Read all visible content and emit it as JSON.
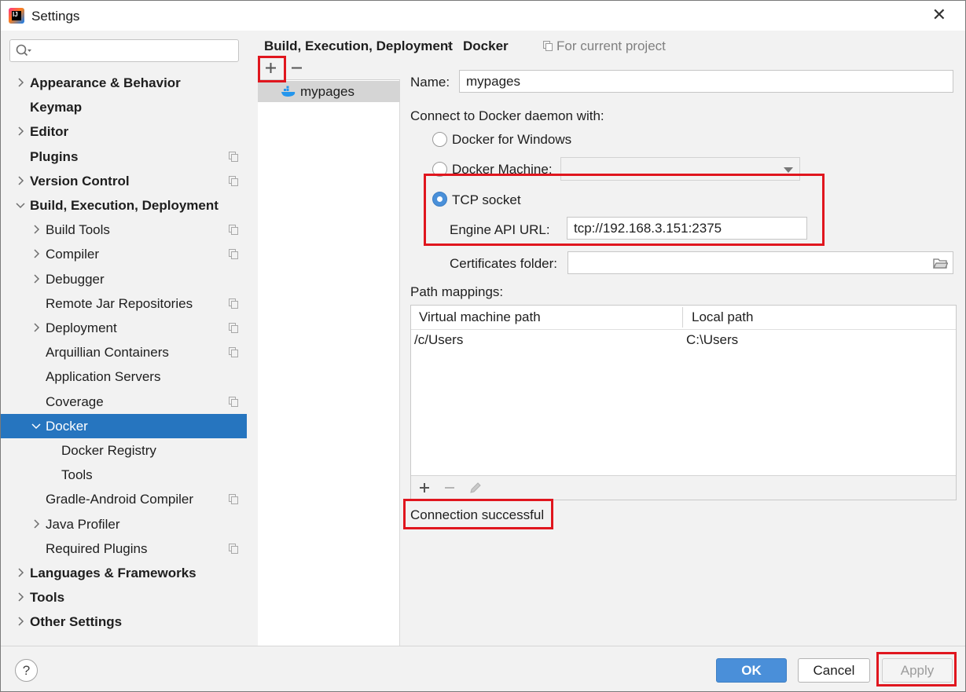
{
  "window": {
    "title": "Settings",
    "app_icon_text": "IJ"
  },
  "sidebar": {
    "search_placeholder": "",
    "items": [
      {
        "label": "Appearance & Behavior",
        "bold": true,
        "level": 0,
        "chevron": "right"
      },
      {
        "label": "Keymap",
        "bold": true,
        "level": 0,
        "chevron": "none"
      },
      {
        "label": "Editor",
        "bold": true,
        "level": 0,
        "chevron": "right"
      },
      {
        "label": "Plugins",
        "bold": true,
        "level": 0,
        "chevron": "none",
        "project": true
      },
      {
        "label": "Version Control",
        "bold": true,
        "level": 0,
        "chevron": "right",
        "project": true
      },
      {
        "label": "Build, Execution, Deployment",
        "bold": true,
        "level": 0,
        "chevron": "down"
      },
      {
        "label": "Build Tools",
        "bold": false,
        "level": 1,
        "chevron": "right",
        "project": true
      },
      {
        "label": "Compiler",
        "bold": false,
        "level": 1,
        "chevron": "right",
        "project": true
      },
      {
        "label": "Debugger",
        "bold": false,
        "level": 1,
        "chevron": "right"
      },
      {
        "label": "Remote Jar Repositories",
        "bold": false,
        "level": 1,
        "chevron": "none",
        "project": true
      },
      {
        "label": "Deployment",
        "bold": false,
        "level": 1,
        "chevron": "right",
        "project": true
      },
      {
        "label": "Arquillian Containers",
        "bold": false,
        "level": 1,
        "chevron": "none",
        "project": true
      },
      {
        "label": "Application Servers",
        "bold": false,
        "level": 1,
        "chevron": "none"
      },
      {
        "label": "Coverage",
        "bold": false,
        "level": 1,
        "chevron": "none",
        "project": true
      },
      {
        "label": "Docker",
        "bold": false,
        "level": 1,
        "chevron": "down",
        "selected": true
      },
      {
        "label": "Docker Registry",
        "bold": false,
        "level": 2,
        "chevron": "none"
      },
      {
        "label": "Tools",
        "bold": false,
        "level": 2,
        "chevron": "none"
      },
      {
        "label": "Gradle-Android Compiler",
        "bold": false,
        "level": 1,
        "chevron": "none",
        "project": true
      },
      {
        "label": "Java Profiler",
        "bold": false,
        "level": 1,
        "chevron": "right"
      },
      {
        "label": "Required Plugins",
        "bold": false,
        "level": 1,
        "chevron": "none",
        "project": true
      },
      {
        "label": "Languages & Frameworks",
        "bold": true,
        "level": 0,
        "chevron": "right"
      },
      {
        "label": "Tools",
        "bold": true,
        "level": 0,
        "chevron": "right"
      },
      {
        "label": "Other Settings",
        "bold": true,
        "level": 0,
        "chevron": "right"
      }
    ]
  },
  "breadcrumb": {
    "parent": "Build, Execution, Deployment",
    "current": "Docker",
    "scope": "For current project"
  },
  "docker_list": {
    "items": [
      "mypages"
    ]
  },
  "form": {
    "name_label": "Name:",
    "name_value": "mypages",
    "connect_label": "Connect to Docker daemon with:",
    "option_windows": "Docker for Windows",
    "option_machine": "Docker Machine:",
    "option_tcp": "TCP socket",
    "selected_option": "tcp",
    "engine_label": "Engine API URL:",
    "engine_value": "tcp://192.168.3.151:2375",
    "certs_label": "Certificates folder:",
    "certs_value": "",
    "path_mappings_label": "Path mappings:",
    "status": "Connection successful"
  },
  "path_table": {
    "columns": [
      "Virtual machine path",
      "Local path"
    ],
    "rows": [
      [
        "/c/Users",
        "C:\\Users"
      ]
    ]
  },
  "footer": {
    "help_label": "?",
    "ok_label": "OK",
    "cancel_label": "Cancel",
    "apply_label": "Apply"
  },
  "colors": {
    "accent": "#2675bf",
    "ok_button": "#4a8fd9",
    "highlight_box": "#e0161e"
  }
}
